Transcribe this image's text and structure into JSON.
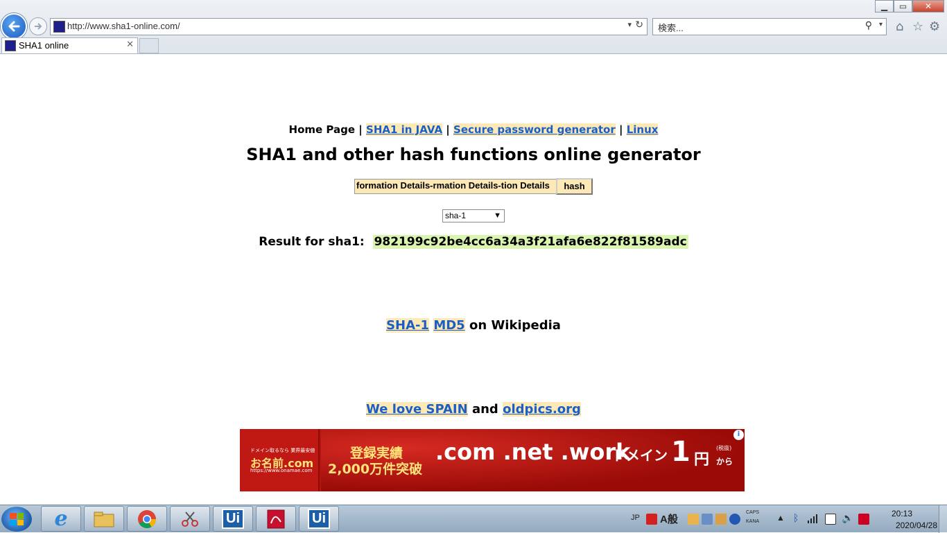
{
  "browser": {
    "url": "http://www.sha1-online.com/",
    "search_placeholder": "検索...",
    "tab_title": "SHA1 online",
    "window_controls": {
      "minimize": "▁",
      "restore": "▭",
      "close": "✕"
    }
  },
  "nav": {
    "home": "Home Page",
    "sep": "|",
    "links": [
      "SHA1 in JAVA",
      "Secure password generator",
      "Linux"
    ]
  },
  "main": {
    "title": "SHA1 and other hash functions online generator",
    "input_value": "formation Details-rmation Details-tion Details",
    "hash_button": "hash",
    "algorithm": "sha-1",
    "result_label": "Result for sha1:",
    "result_hash": "982199c92be4cc6a34a3f21afa6e822f81589adc"
  },
  "wiki": {
    "link1": "SHA-1",
    "link2": "MD5",
    "suffix": "on Wikipedia"
  },
  "promo": {
    "link1": "We love SPAIN",
    "conj": "and",
    "link2": "oldpics.org"
  },
  "ad": {
    "small_text": "ドメイン取るなら 業界最安値",
    "logo": "お名前.com",
    "logo_url": "https://www.onamae.com",
    "record_line1": "登録実績",
    "record_line2": "2,000万件突破",
    "domains": ".com .net .work",
    "domain_word": "ドメイン",
    "price": "1",
    "yen": "円",
    "tax_note": "(税抜)",
    "kara": "から",
    "info": "i"
  },
  "taskbar": {
    "app_labels": [
      "e",
      "",
      "",
      "",
      "Ui",
      "",
      "Ui"
    ],
    "lang": "JP",
    "ime": "A般",
    "caps": "CAPS",
    "kana": "KANA",
    "time": "20:13",
    "date": "2020/04/28"
  },
  "colors": {
    "link": "#1a5fc8",
    "link_highlight": "#fde9b6",
    "result_highlight": "#d9f5b0",
    "ad_red": "#b5140f"
  }
}
